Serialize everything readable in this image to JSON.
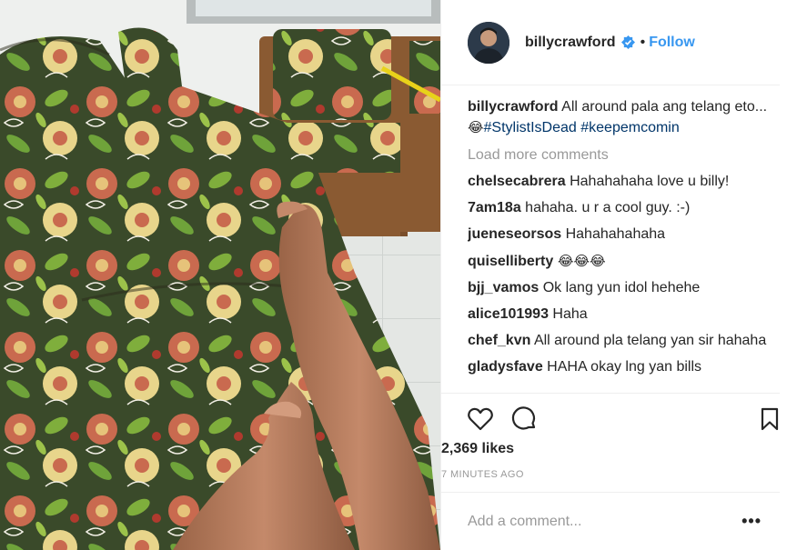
{
  "post": {
    "username": "billycrawford",
    "follow_label": "Follow",
    "separator": "•",
    "caption_user": "billycrawford",
    "caption_text": " All around pala ang telang eto... ",
    "caption_emoji": "😂",
    "hashtags": [
      "#StylistIsDead",
      "#keepemcomin"
    ],
    "load_more": "Load more comments",
    "comments": [
      {
        "user": "chelsecabrera",
        "text": " Hahahahaha love u billy!"
      },
      {
        "user": "7am18a",
        "text": " hahaha. u r a cool guy. :-)"
      },
      {
        "user": "jueneseorsos",
        "text": " Hahahahahaha"
      },
      {
        "user": "quiselliberty",
        "text": " 😂😂😂"
      },
      {
        "user": "bjj_vamos",
        "text": " Ok lang yun idol hehehe"
      },
      {
        "user": "alice101993",
        "text": " Haha"
      },
      {
        "user": "chef_kvn",
        "text": " All around pla telang yan sir hahaha"
      },
      {
        "user": "gladysfave",
        "text": "  HAHA okay lng yan bills"
      }
    ],
    "likes": "2,369 likes",
    "time_ago": "7 MINUTES AGO",
    "add_comment_placeholder": "Add a comment...",
    "more_label": "•••"
  },
  "icons": {
    "like": "heart-icon",
    "comment": "comment-icon",
    "save": "bookmark-icon",
    "verified": "verified-badge-icon"
  },
  "colors": {
    "accent": "#3897f0",
    "hashtag": "#003569",
    "muted": "#999999",
    "text": "#262626"
  }
}
